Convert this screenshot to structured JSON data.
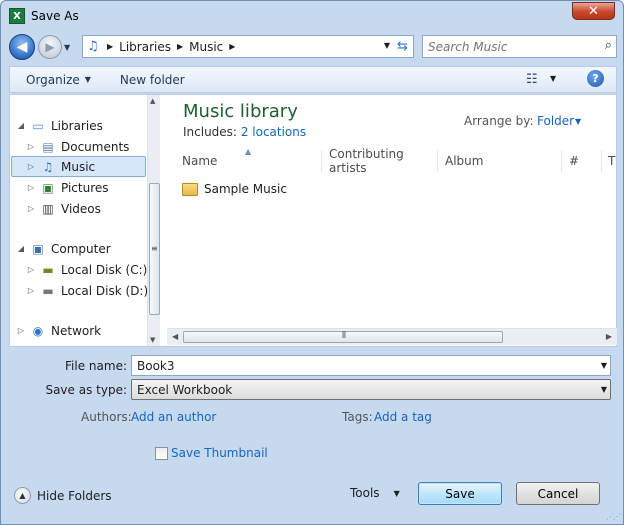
{
  "window": {
    "title": "Save As",
    "app_icon_text": "X",
    "close_glyph": "✕"
  },
  "address": {
    "breadcrumbs": [
      "Libraries",
      "Music"
    ],
    "search_placeholder": "Search Music"
  },
  "toolbar": {
    "organize_label": "Organize",
    "new_folder_label": "New folder",
    "help_glyph": "?"
  },
  "nav_tree": {
    "libraries": "Libraries",
    "documents": "Documents",
    "music": "Music",
    "pictures": "Pictures",
    "videos": "Videos",
    "computer": "Computer",
    "local_c": "Local Disk (C:)",
    "local_d": "Local Disk (D:)",
    "network": "Network"
  },
  "library": {
    "title": "Music library",
    "includes_label": "Includes:",
    "includes_link": "2 locations",
    "arrange_label": "Arrange by:",
    "arrange_value": "Folder"
  },
  "columns": [
    "Name",
    "Contributing artists",
    "Album",
    "#",
    "Ti"
  ],
  "files": [
    {
      "name": "Sample Music",
      "type": "folder"
    }
  ],
  "form": {
    "filename_label": "File name:",
    "filename_value": "Book3",
    "savetype_label": "Save as type:",
    "savetype_value": "Excel Workbook",
    "authors_label": "Authors:",
    "authors_link": "Add an author",
    "tags_label": "Tags:",
    "tags_link": "Add a tag",
    "thumbnail_label": "Save Thumbnail",
    "thumbnail_checked": false
  },
  "footer": {
    "hide_folders": "Hide Folders",
    "tools": "Tools",
    "save": "Save",
    "cancel": "Cancel"
  },
  "colors": {
    "library_title": "#1e5f2f",
    "link": "#1565c0",
    "selection": "#d6e7fb",
    "window_frame": "#c7d9ef"
  },
  "icons": [
    "excel-icon",
    "close-icon",
    "back-icon",
    "forward-icon",
    "music-note-icon",
    "refresh-icon",
    "search-icon",
    "views-icon",
    "help-icon",
    "library-icon",
    "documents-icon",
    "pictures-icon",
    "videos-icon",
    "computer-icon",
    "drive-c-icon",
    "drive-d-icon",
    "network-icon",
    "folder-icon",
    "hide-folders-icon"
  ]
}
